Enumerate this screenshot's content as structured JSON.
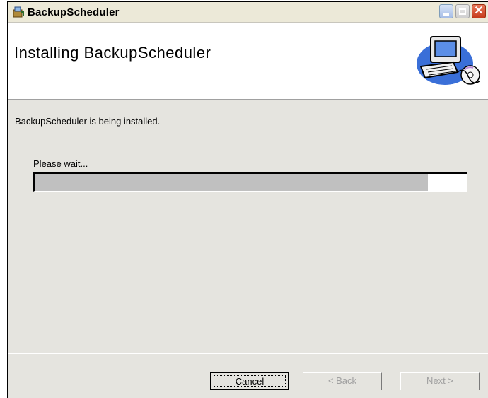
{
  "window": {
    "title": "BackupScheduler"
  },
  "header": {
    "title": "Installing BackupScheduler"
  },
  "main": {
    "status_text": "BackupScheduler is being installed.",
    "progress_label": "Please wait...",
    "progress_fraction": 0.91
  },
  "footer": {
    "cancel_label": "Cancel",
    "back_label": "< Back",
    "next_label": "Next >"
  },
  "colors": {
    "dialog_bg": "#e5e4df",
    "progress_fill": "#c0c0c0",
    "close_button": "#c53b1b"
  },
  "icons": {
    "app": "installer-icon",
    "header_art": "computer-disc-icon",
    "minimize": "minimize-icon",
    "maximize": "maximize-icon",
    "close": "close-icon"
  }
}
